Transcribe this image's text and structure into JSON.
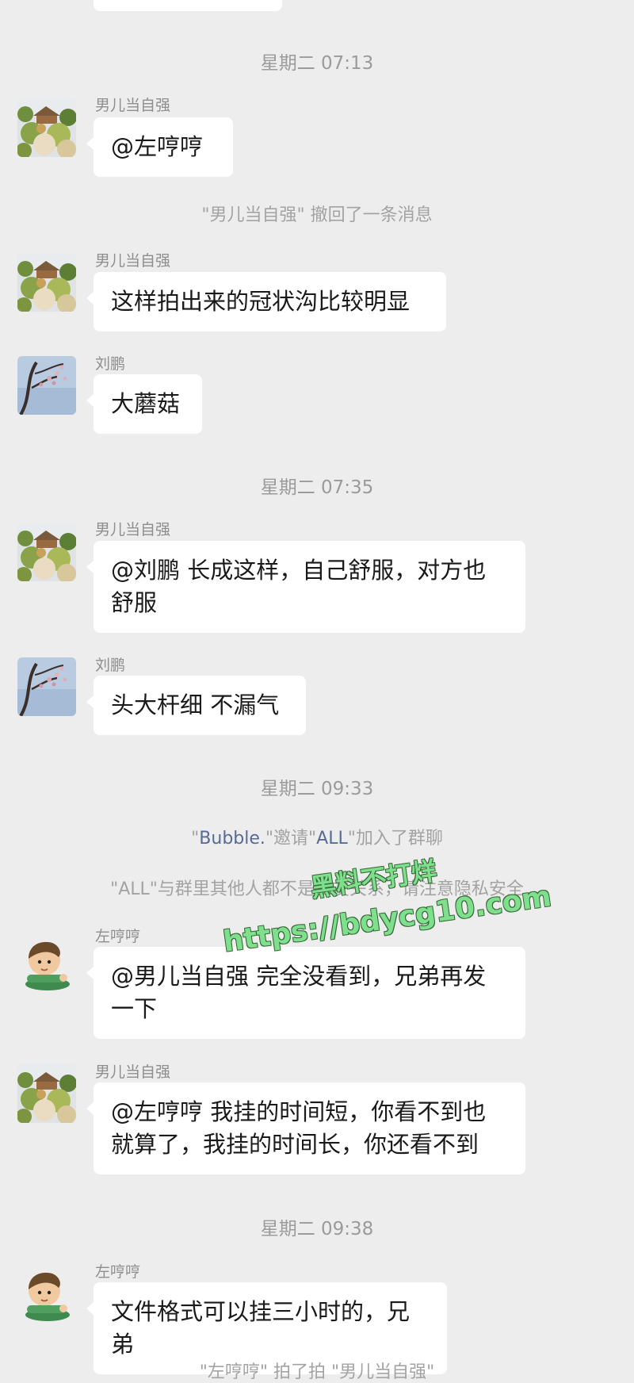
{
  "timestamps": [
    "星期二 07:13",
    "星期二 07:35",
    "星期二 09:33",
    "星期二 09:38"
  ],
  "system": {
    "recall": "\"男儿当自强\" 撤回了一条消息",
    "invite_q1": "\"",
    "invite_name1": "Bubble.",
    "invite_mid": "\"邀请\"",
    "invite_name2": "ALL",
    "invite_end": "\"加入了群聊",
    "privacy": "\"ALL\"与群里其他人都不是朋友关系，请注意隐私安全",
    "pat_partial": "\"左哼哼\" 拍了拍 \"男儿当自强\""
  },
  "messages": [
    {
      "sender": "男儿当自强",
      "text": "@左哼哼",
      "avatar": "landscape-avatar"
    },
    {
      "sender": "男儿当自强",
      "text": "这样拍出来的冠状沟比较明显",
      "avatar": "landscape-avatar"
    },
    {
      "sender": "刘鹏",
      "text": "大蘑菇",
      "avatar": "blossom-avatar"
    },
    {
      "sender": "男儿当自强",
      "text": "@刘鹏 长成这样，自己舒服，对方也舒服",
      "avatar": "landscape-avatar"
    },
    {
      "sender": "刘鹏",
      "text": "头大杆细 不漏气",
      "avatar": "blossom-avatar"
    },
    {
      "sender": "左哼哼",
      "text": "@男儿当自强 完全没看到，兄弟再发一下",
      "avatar": "cartoon-boy-avatar"
    },
    {
      "sender": "男儿当自强",
      "text": "@左哼哼 我挂的时间短，你看不到也就算了，我挂的时间长，你还看不到",
      "avatar": "landscape-avatar"
    },
    {
      "sender": "左哼哼",
      "text": "文件格式可以挂三小时的，兄弟",
      "avatar": "cartoon-boy-avatar"
    }
  ],
  "watermark": {
    "line1": "黑料不打烊",
    "line2": "https://bdycg10.com"
  },
  "colors": {
    "background": "#ededed",
    "bubble": "#ffffff",
    "link_name": "#576b95",
    "watermark": "#7ee08c"
  }
}
